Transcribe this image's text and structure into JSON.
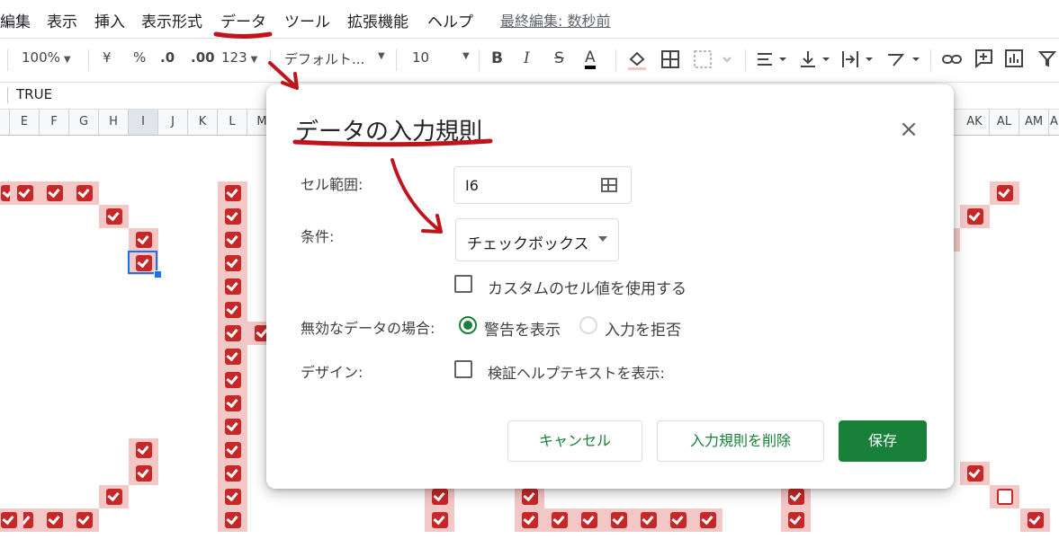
{
  "menu": {
    "items": [
      "編集",
      "表示",
      "挿入",
      "表示形式",
      "データ",
      "ツール",
      "拡張機能",
      "ヘルプ"
    ],
    "last_edit": "最終編集: 数秒前"
  },
  "toolbar": {
    "zoom": "100%",
    "currency": "¥",
    "percent": "%",
    "dec_decrease": ".0",
    "dec_increase": ".00",
    "number_format": "123",
    "font": "デフォルト...",
    "font_size": "10",
    "bold": "B",
    "italic": "I",
    "strike": "S",
    "text_color": "A"
  },
  "formula_bar": {
    "value": "TRUE"
  },
  "columns": [
    "E",
    "F",
    "G",
    "H",
    "I",
    "J",
    "K",
    "L",
    "M",
    "AK",
    "AL",
    "AM",
    "A"
  ],
  "dialog": {
    "title": "データの入力規則",
    "close_icon": "×",
    "cell_range_label": "セル範囲:",
    "cell_range_value": "I6",
    "criteria_label": "条件:",
    "criteria_value": "チェックボックス",
    "custom_values_label": "カスタムのセル値を使用する",
    "invalid_label": "無効なデータの場合:",
    "invalid_options": [
      "警告を表示",
      "入力を拒否"
    ],
    "invalid_selected": 0,
    "appearance_label": "デザイン:",
    "help_text_label": "検証ヘルプテキストを表示:",
    "cancel": "キャンセル",
    "remove": "入力規則を削除",
    "save": "保存"
  },
  "colors": {
    "accent_green": "#188038",
    "checkbox_red": "#c62828",
    "cell_highlight": "#f4c7c7",
    "annotation_red": "#c0141c",
    "selection_blue": "#1a73e8"
  }
}
